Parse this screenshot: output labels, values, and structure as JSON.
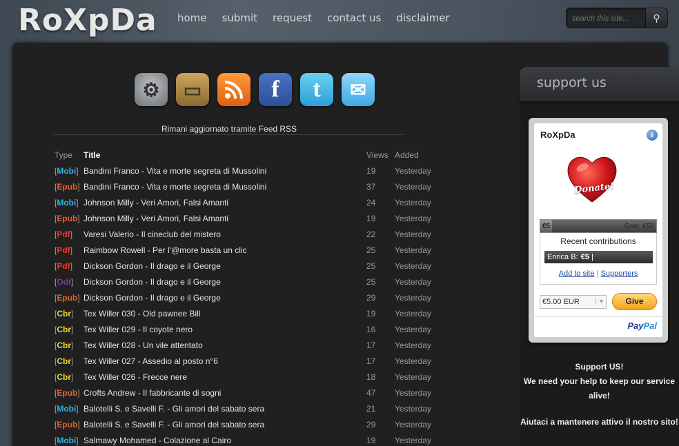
{
  "site": {
    "logo": "RoXpDa"
  },
  "nav": {
    "items": [
      "home",
      "submit",
      "request",
      "contact us",
      "disclaimer"
    ]
  },
  "search": {
    "placeholder": "search this site...",
    "button_icon": "search-icon"
  },
  "social": {
    "icons": [
      "settings-icon",
      "tv-icon",
      "rss-icon",
      "facebook-icon",
      "twitter-icon",
      "mail-icon"
    ],
    "feed_text": "Rimani aggiornato tramite Feed RSS"
  },
  "table": {
    "headers": {
      "type": "Type",
      "title": "Title",
      "views": "Views",
      "added": "Added"
    },
    "type_colors": {
      "Mobi": "#3aaee6",
      "Epub": "#e0602c",
      "Pdf": "#e03c2c",
      "Odt": "#7a3c9a",
      "Cbr": "#e8d23c"
    },
    "rows": [
      {
        "type": "Mobi",
        "title": "Bandini Franco - Vita e morte segreta di Mussolini",
        "views": "19",
        "added": "Yesterday"
      },
      {
        "type": "Epub",
        "title": "Bandini Franco - Vita e morte segreta di Mussolini",
        "views": "37",
        "added": "Yesterday"
      },
      {
        "type": "Mobi",
        "title": "Johnson Milly - Veri Amori, Falsi Amanti",
        "views": "24",
        "added": "Yesterday"
      },
      {
        "type": "Epub",
        "title": "Johnson Milly - Veri Amori, Falsi Amanti",
        "views": "19",
        "added": "Yesterday"
      },
      {
        "type": "Pdf",
        "title": "Varesi Valerio - Il cineclub del mistero",
        "views": "22",
        "added": "Yesterday"
      },
      {
        "type": "Pdf",
        "title": "Raimbow Rowell - Per l'@more basta un clic",
        "views": "25",
        "added": "Yesterday"
      },
      {
        "type": "Pdf",
        "title": "Dickson Gordon - Il drago e il George",
        "views": "25",
        "added": "Yesterday"
      },
      {
        "type": "Odt",
        "title": "Dickson Gordon - Il drago e il George",
        "views": "25",
        "added": "Yesterday"
      },
      {
        "type": "Epub",
        "title": "Dickson Gordon - Il drago e il George",
        "views": "29",
        "added": "Yesterday"
      },
      {
        "type": "Cbr",
        "title": "Tex Willer 030 - Old pawnee Bill",
        "views": "19",
        "added": "Yesterday"
      },
      {
        "type": "Cbr",
        "title": "Tex Willer 029 - Il coyote nero",
        "views": "16",
        "added": "Yesterday"
      },
      {
        "type": "Cbr",
        "title": "Tex Willer 028 - Un vile attentato",
        "views": "17",
        "added": "Yesterday"
      },
      {
        "type": "Cbr",
        "title": "Tex Willer 027 - Assedio al posto n°6",
        "views": "17",
        "added": "Yesterday"
      },
      {
        "type": "Cbr",
        "title": "Tex Willer 026 - Frecce nere",
        "views": "18",
        "added": "Yesterday"
      },
      {
        "type": "Epub",
        "title": "Crofts Andrew - Il fabbricante di sogni",
        "views": "47",
        "added": "Yesterday"
      },
      {
        "type": "Mobi",
        "title": "Balotelli S. e Savelli F. - Gli amori del sabato sera",
        "views": "21",
        "added": "Yesterday"
      },
      {
        "type": "Epub",
        "title": "Balotelli S. e Savelli F. - Gli amori del sabato sera",
        "views": "29",
        "added": "Yesterday"
      },
      {
        "type": "Mobi",
        "title": "Salmawy Mohamed - Colazione al Cairo",
        "views": "19",
        "added": "Yesterday"
      }
    ]
  },
  "support": {
    "heading": "support us",
    "widget": {
      "title": "RoXpDa",
      "info_icon": "info-icon",
      "donate_label": "Donate!",
      "raised": "€5",
      "goal": "Goal: €50",
      "progress_fraction": 0.1,
      "recent_title": "Recent contributions",
      "recent_name": "Enrica B:",
      "recent_amount": "€5",
      "add_to_site": "Add to site",
      "separator": "|",
      "supporters": "Supporters",
      "amount_value": "€5.00 EUR",
      "give": "Give",
      "paypal_pay": "Pay",
      "paypal_pal": "Pal"
    },
    "text_line1": "Support US!",
    "text_line2": "We need your help to keep our service alive!",
    "text_line3": "Aiutaci a mantenere attivo il nostro sito!"
  }
}
